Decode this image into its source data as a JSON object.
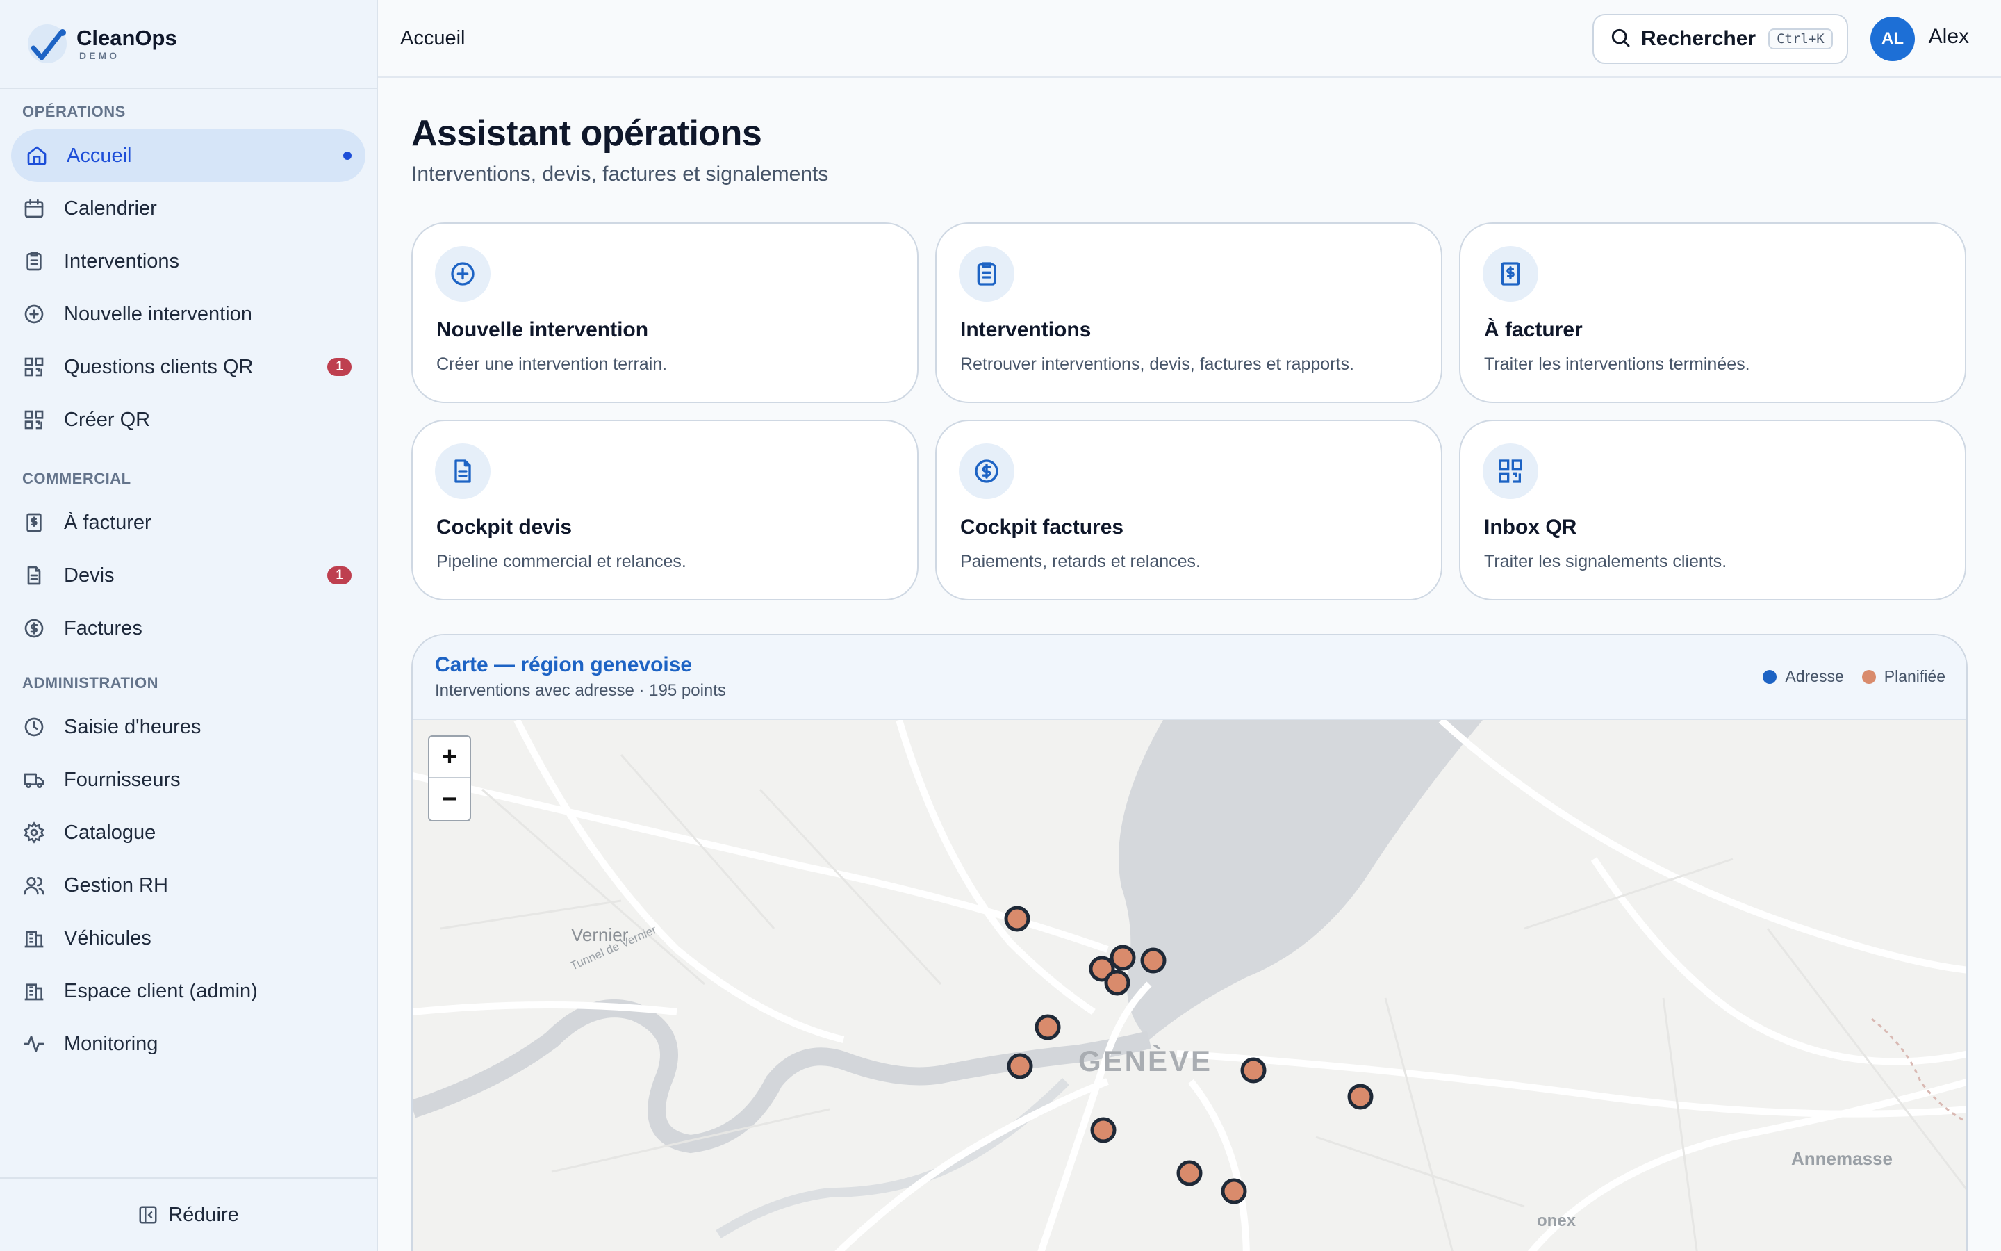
{
  "brand": {
    "name": "CleanOps",
    "sub": "DEMO"
  },
  "sidebar": {
    "sections": [
      {
        "title": "OPÉRATIONS"
      },
      {
        "title": "COMMERCIAL"
      },
      {
        "title": "ADMINISTRATION"
      }
    ],
    "items": [
      {
        "label": "Accueil",
        "icon": "home-icon",
        "active": true
      },
      {
        "label": "Calendrier",
        "icon": "calendar-icon"
      },
      {
        "label": "Interventions",
        "icon": "clipboard-icon"
      },
      {
        "label": "Nouvelle intervention",
        "icon": "plus-circle-icon"
      },
      {
        "label": "Questions clients QR",
        "icon": "qr-code-icon",
        "badge": "1"
      },
      {
        "label": "Créer QR",
        "icon": "qr-code-icon"
      },
      {
        "label": "À facturer",
        "icon": "receipt-icon"
      },
      {
        "label": "Devis",
        "icon": "document-icon",
        "badge": "1"
      },
      {
        "label": "Factures",
        "icon": "dollar-circle-icon"
      },
      {
        "label": "Saisie d'heures",
        "icon": "clock-icon"
      },
      {
        "label": "Fournisseurs",
        "icon": "truck-icon"
      },
      {
        "label": "Catalogue",
        "icon": "gear-icon"
      },
      {
        "label": "Gestion RH",
        "icon": "users-icon"
      },
      {
        "label": "Véhicules",
        "icon": "building-icon"
      },
      {
        "label": "Espace client (admin)",
        "icon": "building-icon"
      },
      {
        "label": "Monitoring",
        "icon": "activity-icon"
      }
    ],
    "footer": {
      "label": "Réduire",
      "icon": "collapse-icon"
    }
  },
  "header": {
    "breadcrumb": "Accueil",
    "search_label": "Rechercher",
    "search_shortcut": "Ctrl+K",
    "avatar_initials": "AL",
    "user_name": "Alex"
  },
  "main": {
    "title": "Assistant opérations",
    "subtitle": "Interventions, devis, factures et signalements",
    "cards": [
      {
        "title": "Nouvelle intervention",
        "desc": "Créer une intervention terrain.",
        "icon": "plus-circle-icon"
      },
      {
        "title": "Interventions",
        "desc": "Retrouver interventions, devis, factures et rapports.",
        "icon": "clipboard-icon"
      },
      {
        "title": "À facturer",
        "desc": "Traiter les interventions terminées.",
        "icon": "receipt-icon"
      },
      {
        "title": "Cockpit devis",
        "desc": "Pipeline commercial et relances.",
        "icon": "document-icon"
      },
      {
        "title": "Cockpit factures",
        "desc": "Paiements, retards et relances.",
        "icon": "dollar-circle-icon"
      },
      {
        "title": "Inbox QR",
        "desc": "Traiter les signalements clients.",
        "icon": "qr-code-icon"
      }
    ],
    "map": {
      "title": "Carte — région genevoise",
      "subtitle": "Interventions avec adresse · 195 points",
      "legend": [
        {
          "label": "Adresse",
          "color": "#1d63c4"
        },
        {
          "label": "Planifiée",
          "color": "#d98b6c"
        }
      ],
      "zoom_in": "+",
      "zoom_out": "−",
      "place_labels": [
        "Vernier",
        "Tunnel de Vernier",
        "GENÈVE",
        "Annemasse",
        "onex"
      ]
    }
  },
  "colors": {
    "accent": "#1d63c4",
    "badge": "#be3f4f",
    "marker": "#d98b6c"
  }
}
